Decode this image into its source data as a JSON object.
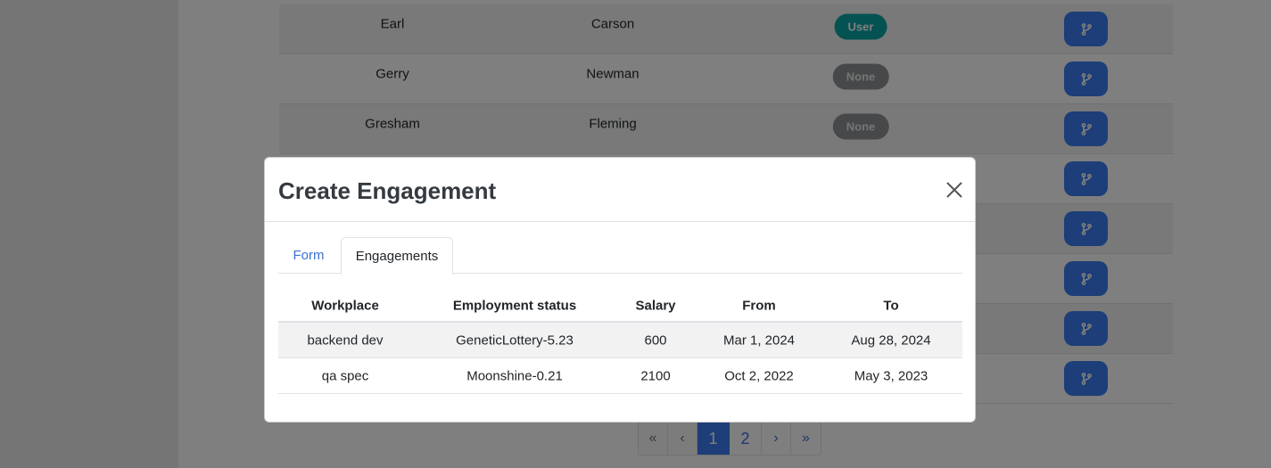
{
  "background_table": {
    "rows": [
      {
        "first_name": "Earl",
        "last_name": "Carson",
        "role": "User"
      },
      {
        "first_name": "Gerry",
        "last_name": "Newman",
        "role": "None"
      },
      {
        "first_name": "Gresham",
        "last_name": "Fleming",
        "role": "None"
      },
      {
        "first_name": "",
        "last_name": "",
        "role": ""
      },
      {
        "first_name": "",
        "last_name": "",
        "role": ""
      },
      {
        "first_name": "",
        "last_name": "",
        "role": ""
      },
      {
        "first_name": "",
        "last_name": "",
        "role": ""
      },
      {
        "first_name": "",
        "last_name": "",
        "role": ""
      }
    ],
    "action_icon": "git-branch-icon"
  },
  "pagination": {
    "first": "«",
    "prev": "‹",
    "pages": [
      "1",
      "2"
    ],
    "active_page": "1",
    "next": "›",
    "last": "»"
  },
  "modal": {
    "title": "Create Engagement",
    "close_icon": "close-icon",
    "tabs": [
      {
        "label": "Form",
        "active": false
      },
      {
        "label": "Engagements",
        "active": true
      }
    ],
    "table": {
      "headers": [
        "Workplace",
        "Employment status",
        "Salary",
        "From",
        "To"
      ],
      "rows": [
        [
          "backend dev",
          "GeneticLottery-5.23",
          "600",
          "Mar 1, 2024",
          "Aug 28, 2024"
        ],
        [
          "qa spec",
          "Moonshine-0.21",
          "2100",
          "Oct 2, 2022",
          "May 3, 2023"
        ]
      ]
    }
  },
  "colors": {
    "primary": "#3b7cf0",
    "badge_user": "#0aa5a5",
    "badge_none": "#8f9194"
  }
}
